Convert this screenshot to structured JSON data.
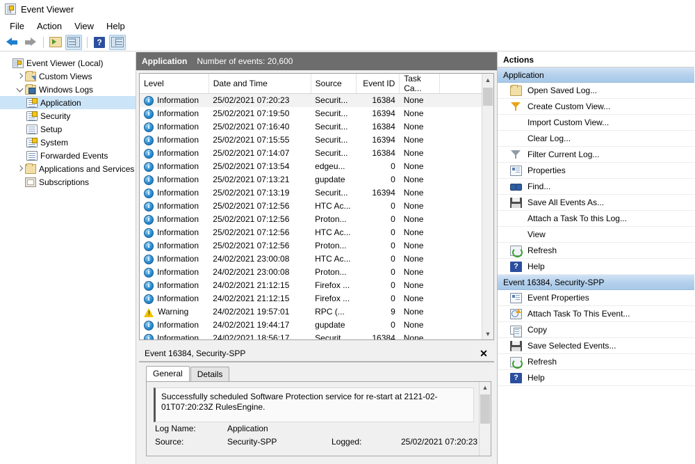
{
  "window": {
    "title": "Event Viewer",
    "icon": "event-viewer-icon"
  },
  "menu": [
    {
      "label": "File"
    },
    {
      "label": "Action"
    },
    {
      "label": "View"
    },
    {
      "label": "Help"
    }
  ],
  "toolbar": [
    {
      "name": "back-button",
      "icon": "arrow-left-icon"
    },
    {
      "name": "forward-button",
      "icon": "arrow-right-icon"
    },
    {
      "name": "open-saved-log-button",
      "icon": "folder-open-icon"
    },
    {
      "name": "show-hide-console-tree-button",
      "icon": "console-tree-icon"
    },
    {
      "name": "help-button",
      "icon": "help-icon"
    },
    {
      "name": "show-hide-action-pane-button",
      "icon": "action-pane-icon"
    }
  ],
  "tree": [
    {
      "label": "Event Viewer (Local)",
      "level": 0,
      "expander": "none",
      "icon": "event-viewer-icon",
      "selected": false
    },
    {
      "label": "Custom Views",
      "level": 1,
      "expander": "closed",
      "icon": "folder-view-icon",
      "selected": false
    },
    {
      "label": "Windows Logs",
      "level": 1,
      "expander": "open",
      "icon": "folder-computer-icon",
      "selected": false
    },
    {
      "label": "Application",
      "level": 2,
      "expander": "none",
      "icon": "log-key-icon",
      "selected": true
    },
    {
      "label": "Security",
      "level": 2,
      "expander": "none",
      "icon": "log-key-icon",
      "selected": false
    },
    {
      "label": "Setup",
      "level": 2,
      "expander": "none",
      "icon": "log-icon",
      "selected": false
    },
    {
      "label": "System",
      "level": 2,
      "expander": "none",
      "icon": "log-key-icon",
      "selected": false
    },
    {
      "label": "Forwarded Events",
      "level": 2,
      "expander": "none",
      "icon": "log-icon",
      "selected": false
    },
    {
      "label": "Applications and Services Lo",
      "level": 1,
      "expander": "closed",
      "icon": "folder-icon",
      "selected": false
    },
    {
      "label": "Subscriptions",
      "level": 1,
      "expander": "none",
      "icon": "subscriptions-icon",
      "selected": false
    }
  ],
  "log_header": {
    "name": "Application",
    "count_label": "Number of events: 20,600"
  },
  "event_list": {
    "columns": [
      "Level",
      "Date and Time",
      "Source",
      "Event ID",
      "Task Ca..."
    ],
    "rows": [
      {
        "level": "Information",
        "icon": "information-icon",
        "datetime": "25/02/2021 07:20:23",
        "source": "Securit...",
        "event_id": "16384",
        "task": "None",
        "selected": true
      },
      {
        "level": "Information",
        "icon": "information-icon",
        "datetime": "25/02/2021 07:19:50",
        "source": "Securit...",
        "event_id": "16394",
        "task": "None",
        "selected": false
      },
      {
        "level": "Information",
        "icon": "information-icon",
        "datetime": "25/02/2021 07:16:40",
        "source": "Securit...",
        "event_id": "16384",
        "task": "None",
        "selected": false
      },
      {
        "level": "Information",
        "icon": "information-icon",
        "datetime": "25/02/2021 07:15:55",
        "source": "Securit...",
        "event_id": "16394",
        "task": "None",
        "selected": false
      },
      {
        "level": "Information",
        "icon": "information-icon",
        "datetime": "25/02/2021 07:14:07",
        "source": "Securit...",
        "event_id": "16384",
        "task": "None",
        "selected": false
      },
      {
        "level": "Information",
        "icon": "information-icon",
        "datetime": "25/02/2021 07:13:54",
        "source": "edgeu...",
        "event_id": "0",
        "task": "None",
        "selected": false
      },
      {
        "level": "Information",
        "icon": "information-icon",
        "datetime": "25/02/2021 07:13:21",
        "source": "gupdate",
        "event_id": "0",
        "task": "None",
        "selected": false
      },
      {
        "level": "Information",
        "icon": "information-icon",
        "datetime": "25/02/2021 07:13:19",
        "source": "Securit...",
        "event_id": "16394",
        "task": "None",
        "selected": false
      },
      {
        "level": "Information",
        "icon": "information-icon",
        "datetime": "25/02/2021 07:12:56",
        "source": "HTC Ac...",
        "event_id": "0",
        "task": "None",
        "selected": false
      },
      {
        "level": "Information",
        "icon": "information-icon",
        "datetime": "25/02/2021 07:12:56",
        "source": "Proton...",
        "event_id": "0",
        "task": "None",
        "selected": false
      },
      {
        "level": "Information",
        "icon": "information-icon",
        "datetime": "25/02/2021 07:12:56",
        "source": "HTC Ac...",
        "event_id": "0",
        "task": "None",
        "selected": false
      },
      {
        "level": "Information",
        "icon": "information-icon",
        "datetime": "25/02/2021 07:12:56",
        "source": "Proton...",
        "event_id": "0",
        "task": "None",
        "selected": false
      },
      {
        "level": "Information",
        "icon": "information-icon",
        "datetime": "24/02/2021 23:00:08",
        "source": "HTC Ac...",
        "event_id": "0",
        "task": "None",
        "selected": false
      },
      {
        "level": "Information",
        "icon": "information-icon",
        "datetime": "24/02/2021 23:00:08",
        "source": "Proton...",
        "event_id": "0",
        "task": "None",
        "selected": false
      },
      {
        "level": "Information",
        "icon": "information-icon",
        "datetime": "24/02/2021 21:12:15",
        "source": "Firefox ...",
        "event_id": "0",
        "task": "None",
        "selected": false
      },
      {
        "level": "Information",
        "icon": "information-icon",
        "datetime": "24/02/2021 21:12:15",
        "source": "Firefox ...",
        "event_id": "0",
        "task": "None",
        "selected": false
      },
      {
        "level": "Warning",
        "icon": "warning-icon",
        "datetime": "24/02/2021 19:57:01",
        "source": "RPC (...",
        "event_id": "9",
        "task": "None",
        "selected": false
      },
      {
        "level": "Information",
        "icon": "information-icon",
        "datetime": "24/02/2021 19:44:17",
        "source": "gupdate",
        "event_id": "0",
        "task": "None",
        "selected": false
      },
      {
        "level": "Information",
        "icon": "information-icon",
        "datetime": "24/02/2021 18:56:17",
        "source": "Securit...",
        "event_id": "16384",
        "task": "None",
        "selected": false
      }
    ]
  },
  "detail": {
    "title": "Event 16384, Security-SPP",
    "close_label": "✕",
    "tabs": [
      {
        "label": "General",
        "active": true
      },
      {
        "label": "Details",
        "active": false
      }
    ],
    "message": "Successfully scheduled Software Protection service for re-start at 2121-02-01T07:20:23Z RulesEngine.",
    "fields": [
      {
        "key": "Log Name:",
        "value": "Application",
        "key2": "",
        "value2": ""
      },
      {
        "key": "Source:",
        "value": "Security-SPP",
        "key2": "Logged:",
        "value2": "25/02/2021 07:20:23"
      }
    ]
  },
  "actions": {
    "title": "Actions",
    "groups": [
      {
        "header": "Application",
        "items": [
          {
            "label": "Open Saved Log...",
            "icon": "open-saved-log-icon"
          },
          {
            "label": "Create Custom View...",
            "icon": "create-custom-view-icon"
          },
          {
            "label": "Import Custom View...",
            "icon": "none"
          },
          {
            "label": "Clear Log...",
            "icon": "none"
          },
          {
            "label": "Filter Current Log...",
            "icon": "filter-icon"
          },
          {
            "label": "Properties",
            "icon": "properties-icon"
          },
          {
            "label": "Find...",
            "icon": "find-icon"
          },
          {
            "label": "Save All Events As...",
            "icon": "save-icon"
          },
          {
            "label": "Attach a Task To this Log...",
            "icon": "none"
          },
          {
            "label": "View",
            "icon": "none"
          },
          {
            "label": "Refresh",
            "icon": "refresh-icon"
          },
          {
            "label": "Help",
            "icon": "help-icon"
          }
        ]
      },
      {
        "header": "Event 16384, Security-SPP",
        "items": [
          {
            "label": "Event Properties",
            "icon": "properties-icon"
          },
          {
            "label": "Attach Task To This Event...",
            "icon": "attach-task-icon"
          },
          {
            "label": "Copy",
            "icon": "copy-icon"
          },
          {
            "label": "Save Selected Events...",
            "icon": "save-icon"
          },
          {
            "label": "Refresh",
            "icon": "refresh-icon"
          },
          {
            "label": "Help",
            "icon": "help-icon"
          }
        ]
      }
    ]
  },
  "colors": {
    "selection_blue": "#cce4f7",
    "group_header_blue": "#a7c8e8",
    "log_header_gray": "#6d6d6d",
    "information_icon": "#2a8fd4",
    "warning_icon": "#f2c200"
  }
}
